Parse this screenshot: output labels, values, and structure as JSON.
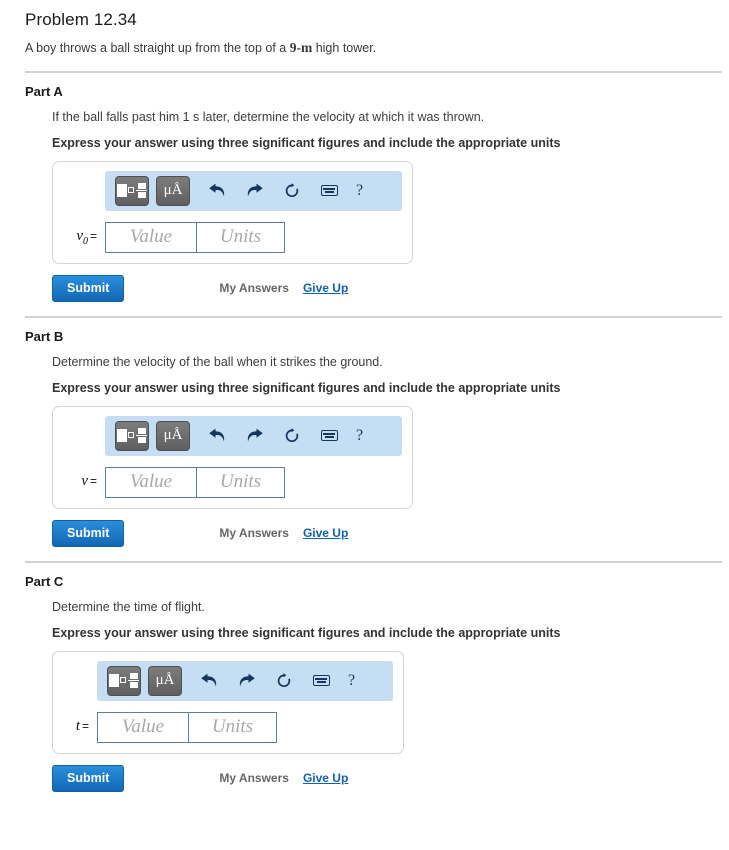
{
  "problem": {
    "title": "Problem 12.34",
    "description_before": "A boy throws a ball straight up from the top of a ",
    "description_unit": "9-m",
    "description_after": " high tower."
  },
  "toolbar": {
    "template_button": "template-icon",
    "units_button": "μÅ",
    "undo": "undo-arrow",
    "redo": "redo-arrow",
    "reset": "reset-arrow",
    "keyboard": "keyboard-icon",
    "help": "?"
  },
  "fields": {
    "value_placeholder": "Value",
    "units_placeholder": "Units"
  },
  "actions": {
    "submit_label": "Submit",
    "my_answers_label": "My Answers",
    "give_up_label": "Give Up"
  },
  "parts": [
    {
      "label": "Part A",
      "question": "If the ball falls past him 1 s later, determine the velocity at which it was thrown.",
      "instruction": "Express your answer using three significant figures and include the appropriate units",
      "variable": "v",
      "subscript": "0",
      "equals": "="
    },
    {
      "label": "Part B",
      "question": "Determine the velocity of the ball when it strikes the ground.",
      "instruction": "Express your answer using three significant figures and include the appropriate units",
      "variable": "v",
      "subscript": "",
      "equals": "="
    },
    {
      "label": "Part C",
      "question": "Determine the time of flight.",
      "instruction": "Express your answer using three significant figures and include the appropriate units",
      "variable": "t",
      "subscript": "",
      "equals": "="
    }
  ],
  "colors": {
    "toolbar_bg": "#c6def4",
    "submit_blue": "#1267b5",
    "link_blue": "#1261ad",
    "icon_navy": "#16365c"
  }
}
